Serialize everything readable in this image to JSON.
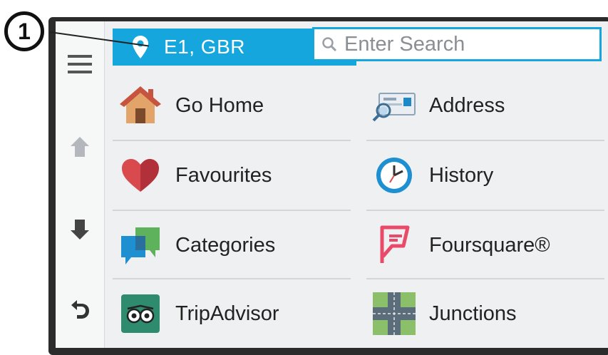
{
  "callout": {
    "number": "1"
  },
  "location": {
    "label": "E1, GBR"
  },
  "search": {
    "placeholder": "Enter Search",
    "value": ""
  },
  "sidebar": {
    "items": [
      {
        "name": "menu"
      },
      {
        "name": "scroll-up"
      },
      {
        "name": "scroll-down"
      },
      {
        "name": "back"
      }
    ]
  },
  "tiles": [
    {
      "label": "Go Home",
      "icon": "house-icon"
    },
    {
      "label": "Address",
      "icon": "address-card-icon"
    },
    {
      "label": "Favourites",
      "icon": "heart-icon"
    },
    {
      "label": "History",
      "icon": "clock-icon"
    },
    {
      "label": "Categories",
      "icon": "speech-bubbles-icon"
    },
    {
      "label": "Foursquare®",
      "icon": "foursquare-icon"
    },
    {
      "label": "TripAdvisor",
      "icon": "tripadvisor-owl-icon"
    },
    {
      "label": "Junctions",
      "icon": "junction-icon"
    }
  ],
  "colors": {
    "accent": "#14a6dc",
    "background": "#eef0f1"
  }
}
